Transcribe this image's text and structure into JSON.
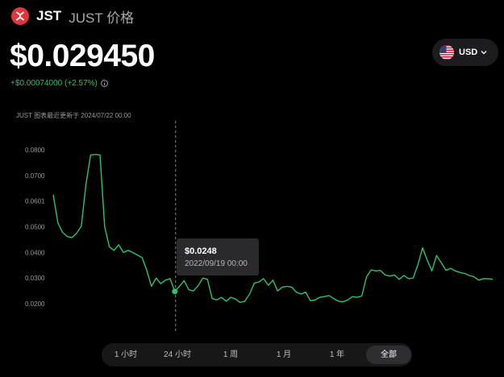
{
  "header": {
    "symbol": "JST",
    "name": "JUST 价格",
    "logo_icon": "just-logo-icon"
  },
  "price": {
    "value": "$0.029450",
    "change": "+$0.00074000 (+2.57%)",
    "change_color": "#2bc46a"
  },
  "currency": {
    "label": "USD",
    "flag_icon": "us-flag-icon",
    "chevron_icon": "chevron-down-icon"
  },
  "updated_text": "JUST 图表最近更新于 2024/07/22 00:00",
  "tooltip": {
    "price": "$0.0248",
    "date": "2022/09/19 00:00"
  },
  "ranges": [
    {
      "label": "1 小时",
      "active": false
    },
    {
      "label": "24 小时",
      "active": false
    },
    {
      "label": "1 周",
      "active": false
    },
    {
      "label": "1 月",
      "active": false
    },
    {
      "label": "1 年",
      "active": false
    },
    {
      "label": "全部",
      "active": true
    }
  ],
  "chart_data": {
    "type": "line",
    "y_tick_labels": [
      "0.0800",
      "0.0700",
      "0.0601",
      "0.0500",
      "0.0400",
      "0.0300",
      "0.0200"
    ],
    "ylim": [
      0.0172,
      0.0847
    ],
    "grid": false,
    "line_color": "#2bc46a",
    "highlighted_point": {
      "index": 26,
      "value": 0.0248,
      "label": "2022/09/19 00:00"
    },
    "series": [
      {
        "values": [
          0.0625,
          0.0515,
          0.0478,
          0.0462,
          0.0458,
          0.0475,
          0.0502,
          0.0665,
          0.078,
          0.0782,
          0.078,
          0.05,
          0.0422,
          0.0408,
          0.043,
          0.04,
          0.0408,
          0.04,
          0.039,
          0.038,
          0.033,
          0.0268,
          0.03,
          0.0278,
          0.0292,
          0.0298,
          0.0248,
          0.0268,
          0.029,
          0.0255,
          0.025,
          0.027,
          0.03,
          0.0295,
          0.022,
          0.0215,
          0.0225,
          0.021,
          0.0225,
          0.0218,
          0.0205,
          0.021,
          0.0238,
          0.028,
          0.0285,
          0.0298,
          0.0272,
          0.0292,
          0.025,
          0.0265,
          0.0268,
          0.0265,
          0.0245,
          0.0238,
          0.0245,
          0.0212,
          0.0215,
          0.0225,
          0.0228,
          0.0232,
          0.022,
          0.021,
          0.0208,
          0.0215,
          0.0228,
          0.0225,
          0.023,
          0.0305,
          0.0332,
          0.0328,
          0.033,
          0.0312,
          0.0308,
          0.0312,
          0.0295,
          0.031,
          0.0298,
          0.03,
          0.0352,
          0.0418,
          0.037,
          0.0328,
          0.0388,
          0.036,
          0.033,
          0.0338,
          0.0328,
          0.0322,
          0.0318,
          0.031,
          0.0305,
          0.0292,
          0.0298,
          0.0298,
          0.0295
        ]
      }
    ]
  }
}
